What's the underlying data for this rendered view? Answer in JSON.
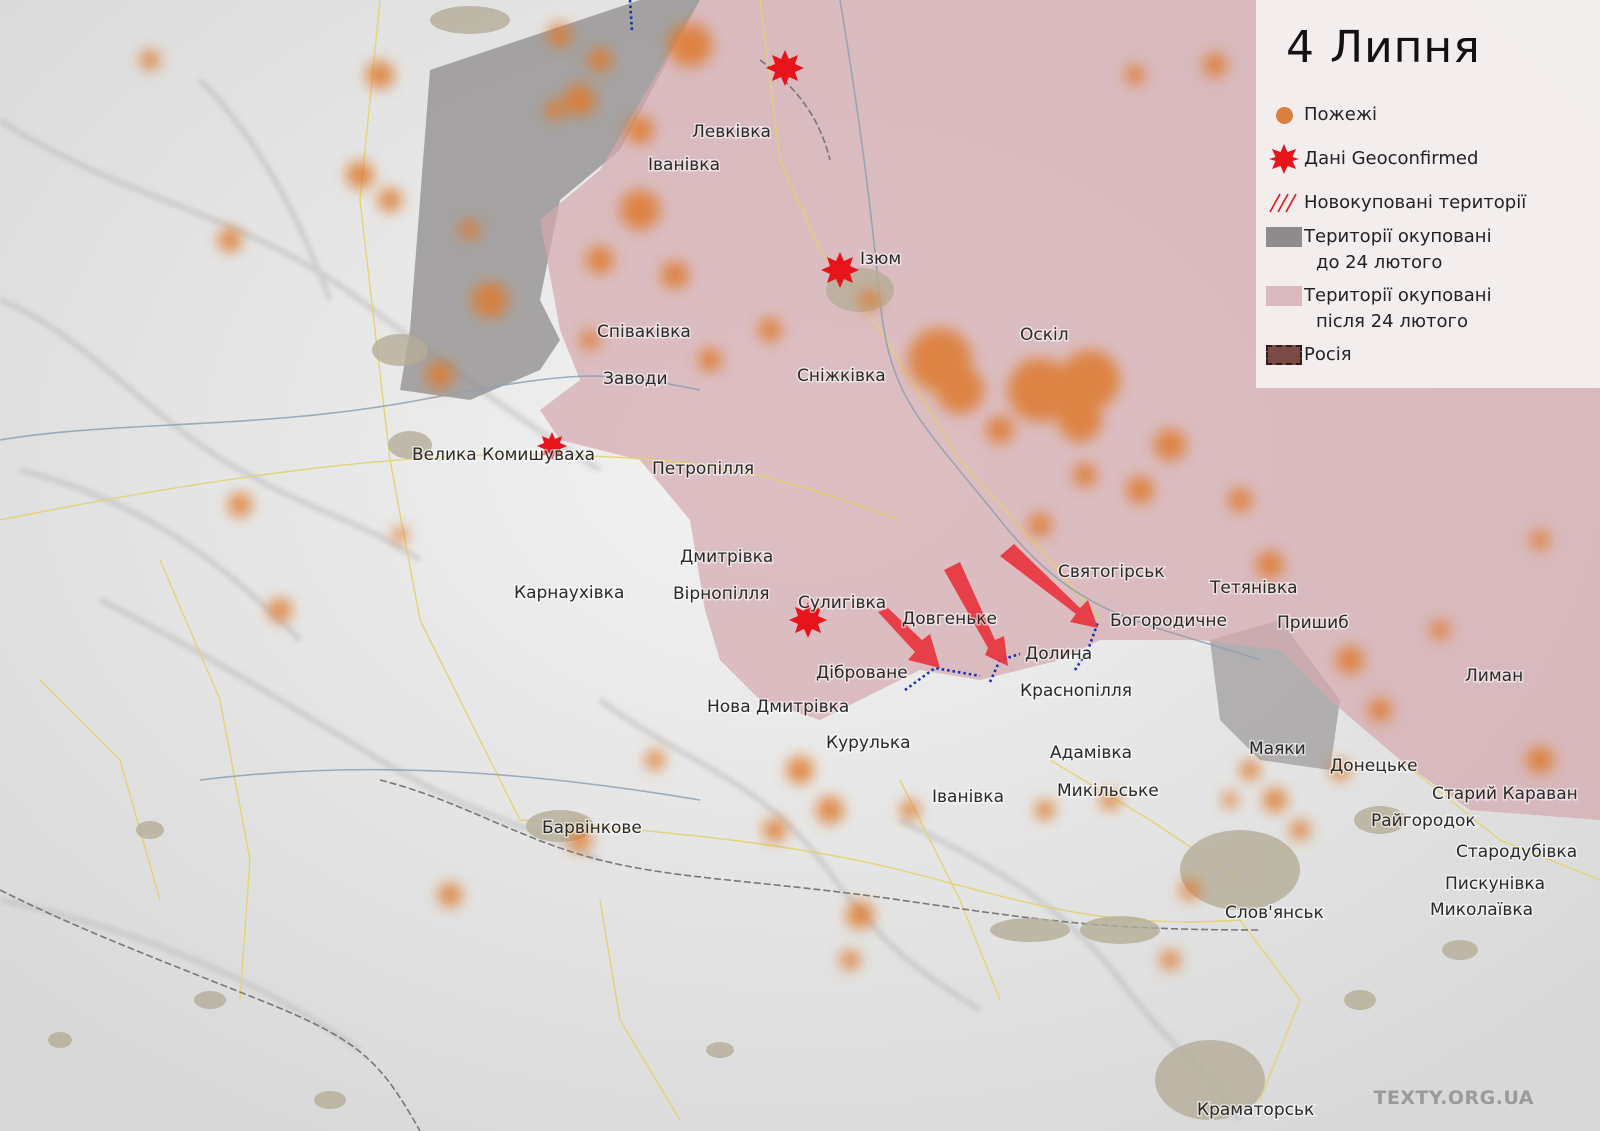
{
  "legend": {
    "title": "4 Липня",
    "items": [
      {
        "label": "Пожежі",
        "icon": "fire-dot-icon"
      },
      {
        "label": "Дані Geoconfirmed",
        "icon": "red-burst-icon"
      },
      {
        "label": "Новокуповані території",
        "icon": "red-hatch-icon"
      },
      {
        "label_line1": "Території окуповані",
        "label_line2": "до 24 лютого",
        "icon": "gray-swatch-icon",
        "color": "#8d8b8b"
      },
      {
        "label_line1": "Території окуповані",
        "label_line2": "після 24 лютого",
        "icon": "pink-swatch-icon",
        "color": "#d9b9bd"
      },
      {
        "label": "Росія",
        "icon": "dark-dashed-swatch-icon",
        "color": "#7a4b46"
      }
    ]
  },
  "places": [
    "Левківка",
    "Іванівка",
    "Ізюм",
    "Оскіл",
    "Співаківка",
    "Заводи",
    "Сніжківка",
    "Велика Комишуваха",
    "Петропілля",
    "Дмитрівка",
    "Карнаухівка",
    "Вірнопілля",
    "Сулигівка",
    "Довгеньке",
    "Святогірськ",
    "Тетянівка",
    "Богородичне",
    "Пришиб",
    "Долина",
    "Діброване",
    "Краснопілля",
    "Нова Дмитрівка",
    "Курулька",
    "Лиман",
    "Адамівка",
    "Маяки",
    "Донецьке",
    "Іванівка",
    "Микільське",
    "Старий Караван",
    "Барвінкове",
    "Райгородок",
    "Стародубівка",
    "Пискунівка",
    "Миколаївка",
    "Слов'янськ",
    "Краматорськ"
  ],
  "credit": "TEXTY.ORG.UA",
  "colors": {
    "fire": "#de7a2e",
    "burst": "#e8141c",
    "arrow": "#e8323c",
    "occupied_before": "#8d8b8b",
    "occupied_after": "#d9b9bd",
    "frontline": "#1a2fb5"
  }
}
